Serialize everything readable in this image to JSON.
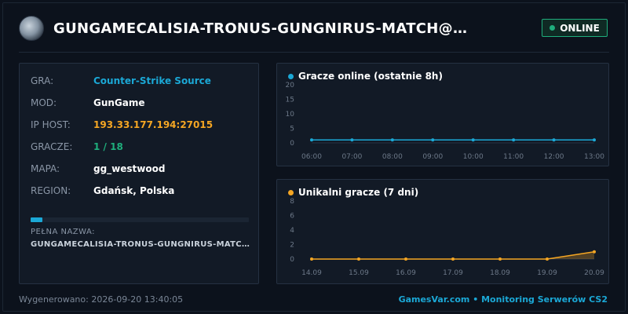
{
  "header": {
    "title": "GUNGAMECALISIA-TRONUS-GUNGNIRUS-MATCH@puk…",
    "status": "ONLINE",
    "status_color": "#1fae7c"
  },
  "info": {
    "rows": [
      {
        "label": "GRA:",
        "value": "Counter-Strike Source"
      },
      {
        "label": "MOD:",
        "value": "GunGame"
      },
      {
        "label": "IP HOST:",
        "value": "193.33.177.194:27015"
      },
      {
        "label": "GRACZE:",
        "value": "1 / 18"
      },
      {
        "label": "MAPA:",
        "value": "gg_westwood"
      },
      {
        "label": "REGION:",
        "value": "Gdańsk, Polska"
      }
    ],
    "player_fill_fraction": 0.0556,
    "fullname_label": "PEŁNA NAZWA:",
    "fullname_value": "GUNGAMECALISIA-TRONUS-GUNGNIRUS-MATCH…"
  },
  "chart_data": [
    {
      "type": "line",
      "title": "Gracze online (ostatnie 8h)",
      "color": "#1ba8d6",
      "categories": [
        "06:00",
        "07:00",
        "08:00",
        "09:00",
        "10:00",
        "11:00",
        "12:00",
        "13:00"
      ],
      "values": [
        1,
        1,
        1,
        1,
        1,
        1,
        1,
        1
      ],
      "yticks": [
        0,
        5,
        10,
        15,
        20
      ],
      "ylim": [
        0,
        20
      ]
    },
    {
      "type": "area",
      "title": "Unikalni gracze (7 dni)",
      "color": "#f5a623",
      "categories": [
        "14.09",
        "15.09",
        "16.09",
        "17.09",
        "18.09",
        "19.09",
        "20.09"
      ],
      "values": [
        0,
        0,
        0,
        0,
        0,
        0,
        1
      ],
      "yticks": [
        0,
        2,
        4,
        6,
        8
      ],
      "ylim": [
        0,
        8
      ]
    }
  ],
  "footer": {
    "generated": "Wygenerowano: 2026-09-20 13:40:05",
    "brand": "GamesVar.com • Monitoring Serwerów CS2"
  }
}
